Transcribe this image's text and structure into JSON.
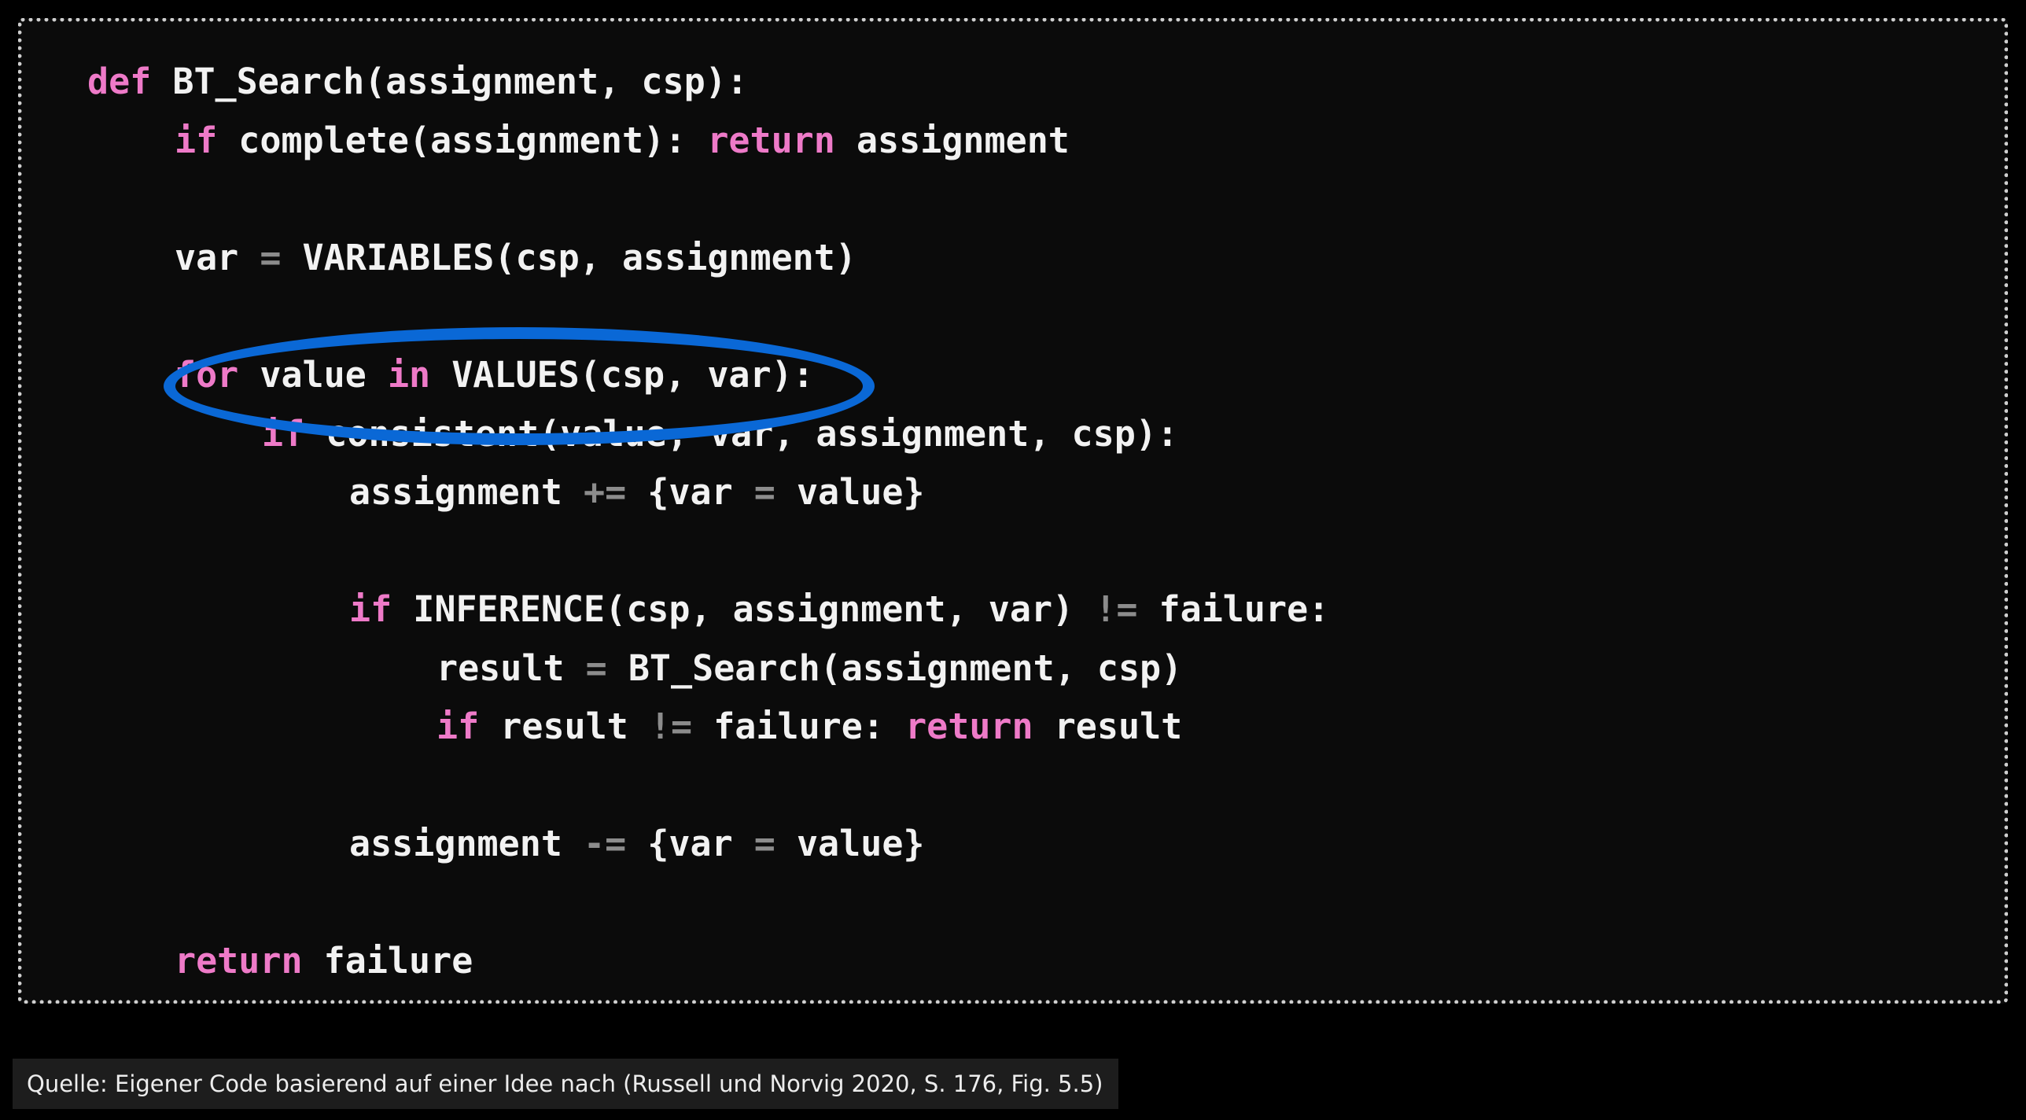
{
  "code": {
    "lines": [
      {
        "tokens": [
          {
            "t": "def",
            "k": "kw"
          },
          {
            "t": " BT_Search(assignment, csp):",
            "k": "id"
          }
        ]
      },
      {
        "tokens": [
          {
            "t": "if",
            "k": "kw"
          },
          {
            "t": " complete(assignment): ",
            "k": "id"
          },
          {
            "t": "return",
            "k": "kw"
          },
          {
            "t": " assignment",
            "k": "id"
          }
        ]
      },
      {
        "tokens": [
          {
            "t": "var ",
            "k": "id"
          },
          {
            "t": "=",
            "k": "op"
          },
          {
            "t": " VARIABLES(csp, assignment)",
            "k": "id"
          }
        ]
      },
      {
        "tokens": [
          {
            "t": "for",
            "k": "kw"
          },
          {
            "t": " value ",
            "k": "id"
          },
          {
            "t": "in",
            "k": "kw"
          },
          {
            "t": " VALUES(csp, var):",
            "k": "id"
          }
        ]
      },
      {
        "tokens": [
          {
            "t": "if",
            "k": "kw"
          },
          {
            "t": " consistent(value, var, assignment, csp):",
            "k": "id"
          }
        ]
      },
      {
        "tokens": [
          {
            "t": "assignment ",
            "k": "id"
          },
          {
            "t": "+=",
            "k": "op"
          },
          {
            "t": " {var ",
            "k": "id"
          },
          {
            "t": "=",
            "k": "op"
          },
          {
            "t": " value}",
            "k": "id"
          }
        ]
      },
      {
        "tokens": [
          {
            "t": "if",
            "k": "kw"
          },
          {
            "t": " INFERENCE(csp, assignment, var) ",
            "k": "id"
          },
          {
            "t": "!=",
            "k": "op"
          },
          {
            "t": " failure:",
            "k": "id"
          }
        ]
      },
      {
        "tokens": [
          {
            "t": "result ",
            "k": "id"
          },
          {
            "t": "=",
            "k": "op"
          },
          {
            "t": " BT_Search(assignment, csp)",
            "k": "id"
          }
        ]
      },
      {
        "tokens": [
          {
            "t": "if",
            "k": "kw"
          },
          {
            "t": " result ",
            "k": "id"
          },
          {
            "t": "!=",
            "k": "op"
          },
          {
            "t": " failure: ",
            "k": "id"
          },
          {
            "t": "return",
            "k": "kw"
          },
          {
            "t": " result",
            "k": "id"
          }
        ]
      },
      {
        "tokens": [
          {
            "t": "assignment ",
            "k": "id"
          },
          {
            "t": "-=",
            "k": "op"
          },
          {
            "t": " {var ",
            "k": "id"
          },
          {
            "t": "=",
            "k": "op"
          },
          {
            "t": " value}",
            "k": "id"
          }
        ]
      },
      {
        "tokens": [
          {
            "t": "return",
            "k": "kw"
          },
          {
            "t": " failure",
            "k": "id"
          }
        ]
      }
    ]
  },
  "highlight": {
    "color": "#0a68d6",
    "target": "for value in VALUES(csp, var):"
  },
  "colors": {
    "keyword": "#ee7ac8",
    "operator": "#8c8c8c",
    "identifier": "#f2f2f2",
    "background": "#0b0b0b",
    "frame_border": "#cfcfcf"
  },
  "caption": {
    "text": "Quelle: Eigener Code basierend auf einer Idee nach (Russell und Norvig 2020, S. 176, Fig. 5.5)"
  }
}
